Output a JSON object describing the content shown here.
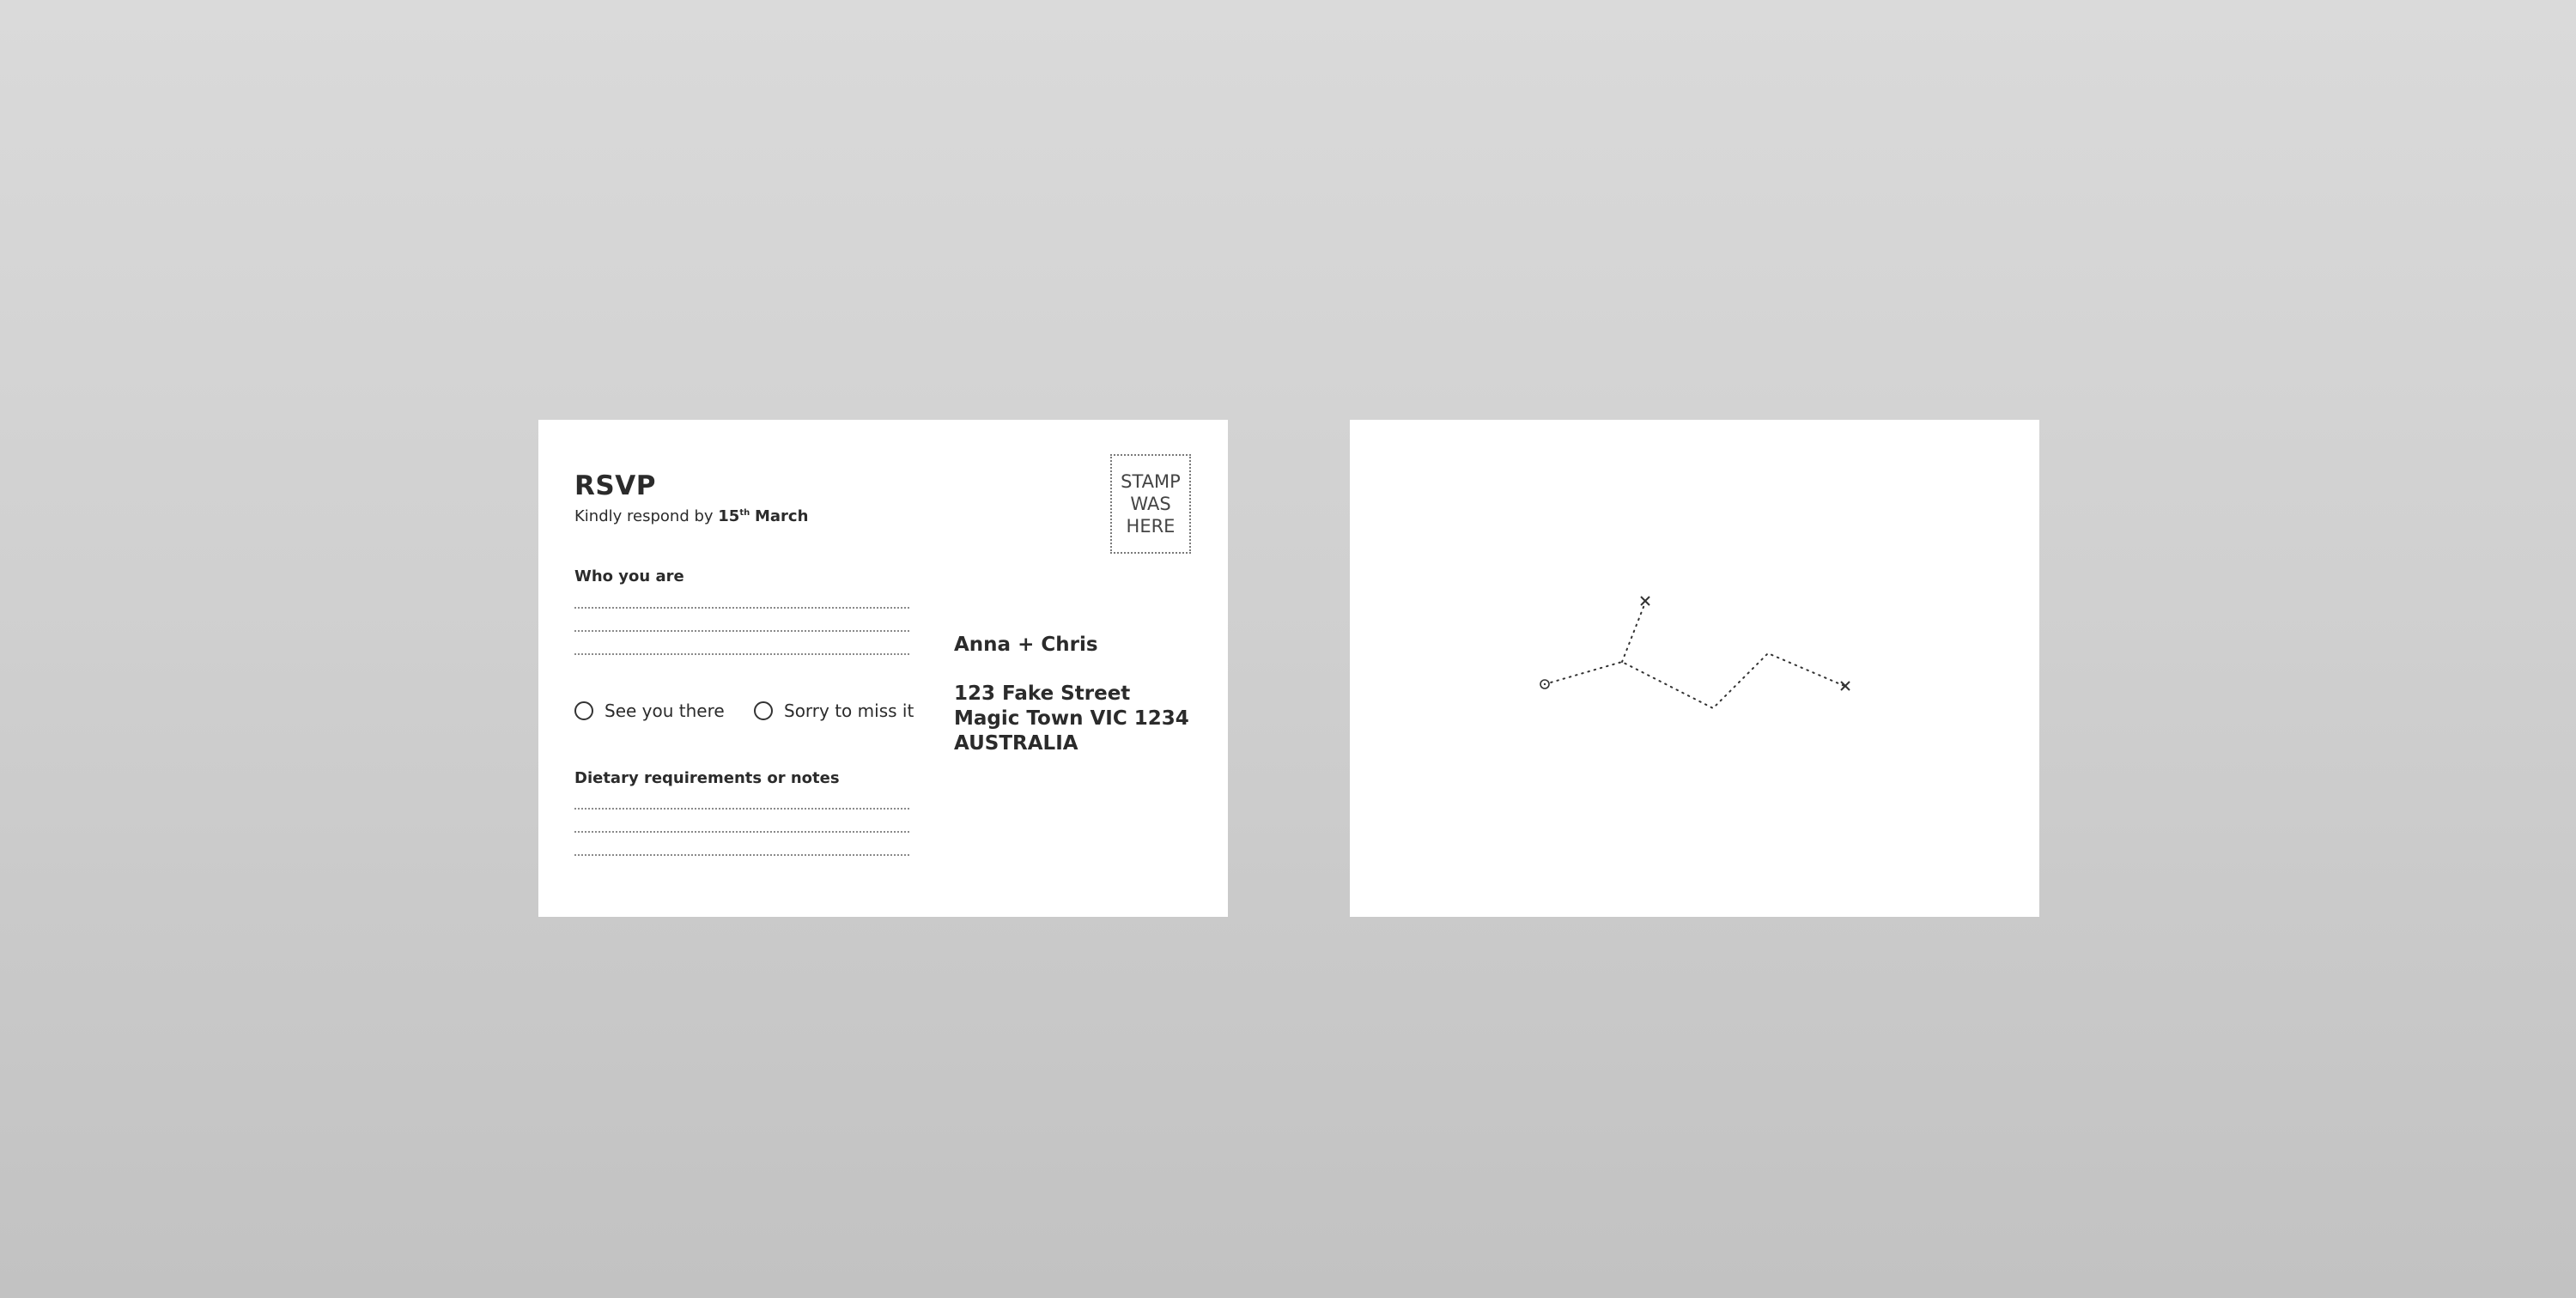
{
  "front": {
    "title": "RSVP",
    "subtitle_prefix": "Kindly respond by",
    "date_day": "15",
    "date_suffix": "th",
    "date_month": "March",
    "stamp_lines": [
      "STAMP",
      "WAS",
      "HERE"
    ],
    "who_label": "Who you are",
    "attend_yes": "See you there",
    "attend_no": "Sorry to miss it",
    "dietary_label": "Dietary requirements or notes",
    "recipient": "Anna + Chris",
    "address_line1": "123 Fake Street",
    "address_line2": "Magic Town VIC 1234",
    "address_line3": "AUSTRALIA"
  },
  "back": {
    "route_markers": [
      "start-circle",
      "end-cross",
      "end-cross"
    ]
  }
}
